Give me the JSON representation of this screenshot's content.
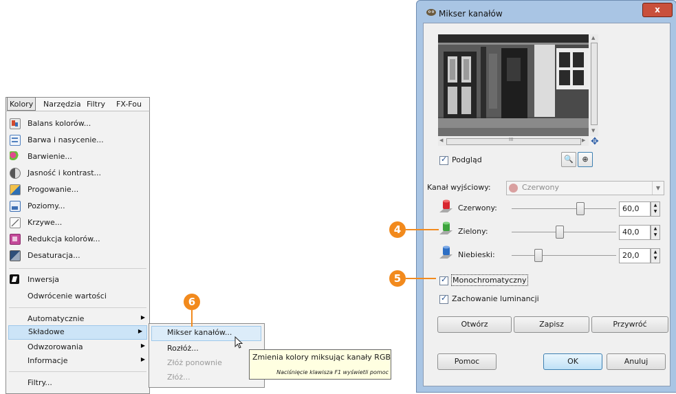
{
  "menubar": {
    "items": [
      "Kolory",
      "Narzędzia",
      "Filtry",
      "FX-Fou"
    ]
  },
  "colors_menu": {
    "items": [
      {
        "label": "Balans kolorów...",
        "icon": "color-balance-icon",
        "color": "#d24a2e"
      },
      {
        "label": "Barwa i nasycenie...",
        "icon": "hue-saturation-icon",
        "color": "#4f7fbe"
      },
      {
        "label": "Barwienie...",
        "icon": "colorize-icon",
        "color": "#d64a8e"
      },
      {
        "label": "Jasność i kontrast...",
        "icon": "brightness-contrast-icon",
        "color": "#8a8a8a"
      },
      {
        "label": "Progowanie...",
        "icon": "threshold-icon",
        "color": "#e09a2a"
      },
      {
        "label": "Poziomy...",
        "icon": "levels-icon",
        "color": "#3d6fb3"
      },
      {
        "label": "Krzywe...",
        "icon": "curves-icon",
        "color": "#8a8a8a"
      },
      {
        "label": "Redukcja kolorów...",
        "icon": "color-reduction-icon",
        "color": "#c44a9a"
      },
      {
        "label": "Desaturacja...",
        "icon": "desaturate-icon",
        "color": "#3e5f8a"
      },
      {
        "label": "Inwersja",
        "icon": "invert-icon",
        "color": "#111111"
      },
      {
        "label": "Odwrócenie wartości",
        "icon": "",
        "color": ""
      },
      {
        "label": "Automatycznie",
        "icon": "",
        "color": "",
        "submenu": true
      },
      {
        "label": "Składowe",
        "icon": "",
        "color": "",
        "submenu": true
      },
      {
        "label": "Odwzorowania",
        "icon": "",
        "color": "",
        "submenu": true
      },
      {
        "label": "Informacje",
        "icon": "",
        "color": "",
        "submenu": true
      },
      {
        "label": "Filtry...",
        "icon": "",
        "color": ""
      }
    ]
  },
  "components_submenu": {
    "items": [
      {
        "label": "Mikser kanałów...",
        "disabled": false
      },
      {
        "label": "Rozłóż...",
        "disabled": false
      },
      {
        "label": "Złóż ponownie",
        "disabled": true
      },
      {
        "label": "Złóż...",
        "disabled": true
      }
    ]
  },
  "tooltip": {
    "text": "Zmienia kolory miksując kanały RGB",
    "hint": "Naciśnięcie klawisza F1 wyświetli pomoc"
  },
  "callouts": {
    "four": "4",
    "five": "5",
    "six": "6"
  },
  "dialog": {
    "title": "Mikser kanałów",
    "close_label": "x",
    "preview_checkbox": "Podgląd",
    "output_channel_label": "Kanał wyjściowy:",
    "output_channel_value": "Czerwony",
    "sliders": [
      {
        "label": "Czerwony:",
        "value": "60,0",
        "fraction": 0.6,
        "color": "#d8262e"
      },
      {
        "label": "Zielony:",
        "value": "40,0",
        "fraction": 0.4,
        "color": "#3ca33c"
      },
      {
        "label": "Niebieski:",
        "value": "20,0",
        "fraction": 0.2,
        "color": "#2e6fc4"
      }
    ],
    "monochrome": "Monochromatyczny",
    "preserve_luminosity": "Zachowanie luminancji",
    "buttons": {
      "open": "Otwórz",
      "save": "Zapisz",
      "reset": "Przywróć",
      "help": "Pomoc",
      "ok": "OK",
      "cancel": "Anuluj"
    },
    "scroll_glyph": "III"
  }
}
